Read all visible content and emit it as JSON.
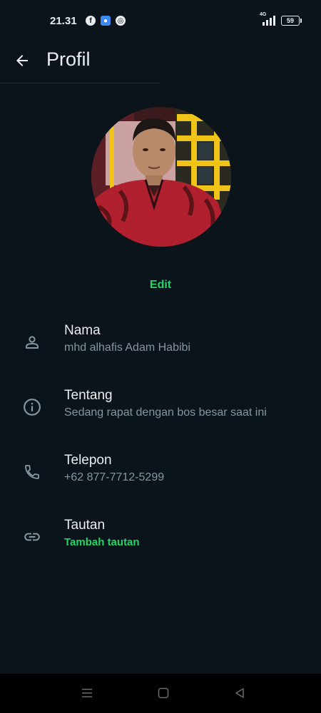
{
  "status_bar": {
    "time": "21.31",
    "app_icons": [
      "facebook-icon",
      "app-icon",
      "chrome-icon"
    ],
    "network": "4G",
    "battery": "59"
  },
  "header": {
    "title": "Profil"
  },
  "profile": {
    "edit_label": "Edit",
    "rows": [
      {
        "icon": "person-icon",
        "title": "Nama",
        "value": "mhd alhafis Adam Habibi"
      },
      {
        "icon": "info-icon",
        "title": "Tentang",
        "value": "Sedang rapat dengan bos besar saat ini"
      },
      {
        "icon": "phone-icon",
        "title": "Telepon",
        "value": "+62 877-7712-5299"
      },
      {
        "icon": "link-icon",
        "title": "Tautan",
        "value": "Tambah tautan"
      }
    ]
  },
  "colors": {
    "background": "#0b141a",
    "accent": "#25d366",
    "secondary_text": "#8696a0",
    "primary_text": "#e9edef"
  },
  "nav_bar": {
    "buttons": [
      "menu-icon",
      "home-icon",
      "back-triangle-icon"
    ]
  }
}
